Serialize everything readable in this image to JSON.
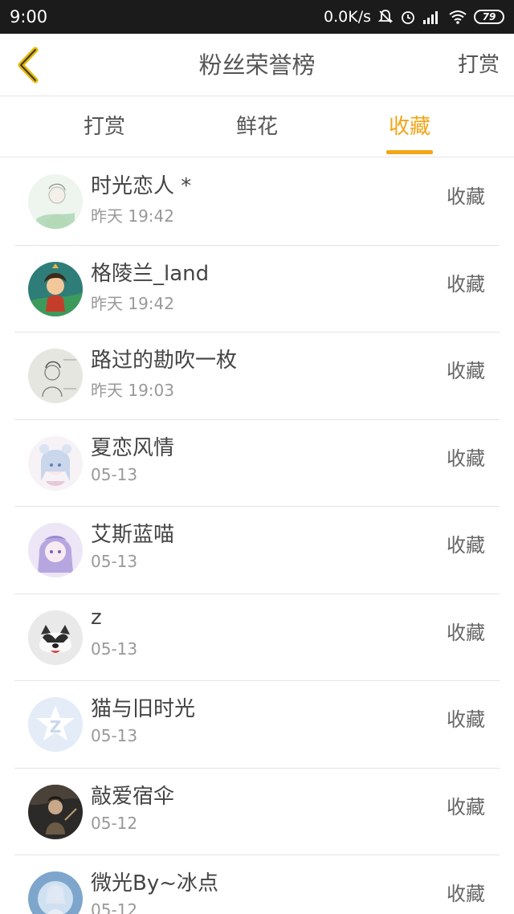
{
  "status_bar": {
    "time": "9:00",
    "network_speed": "0.0K/s",
    "battery": "79"
  },
  "header": {
    "title": "粉丝荣誉榜",
    "action": "打赏",
    "accent_color": "#f2a516"
  },
  "tabs": [
    {
      "label": "打赏",
      "active": false
    },
    {
      "label": "鲜花",
      "active": false
    },
    {
      "label": "收藏",
      "active": true
    }
  ],
  "items": [
    {
      "name": "时光恋人 *",
      "time": "昨天 19:42",
      "action": "收藏"
    },
    {
      "name": "格陵兰_land",
      "time": "昨天 19:42",
      "action": "收藏"
    },
    {
      "name": "路过的勘吹一枚",
      "time": "昨天 19:03",
      "action": "收藏"
    },
    {
      "name": "夏恋风情",
      "time": "05-13",
      "action": "收藏"
    },
    {
      "name": "艾斯蓝喵",
      "time": "05-13",
      "action": "收藏"
    },
    {
      "name": "z",
      "time": "05-13",
      "action": "收藏"
    },
    {
      "name": "猫与旧时光",
      "time": "05-13",
      "action": "收藏"
    },
    {
      "name": "敲爱宿伞",
      "time": "05-12",
      "action": "收藏"
    },
    {
      "name": "微光By~冰点",
      "time": "05-12",
      "action": "收藏"
    }
  ]
}
